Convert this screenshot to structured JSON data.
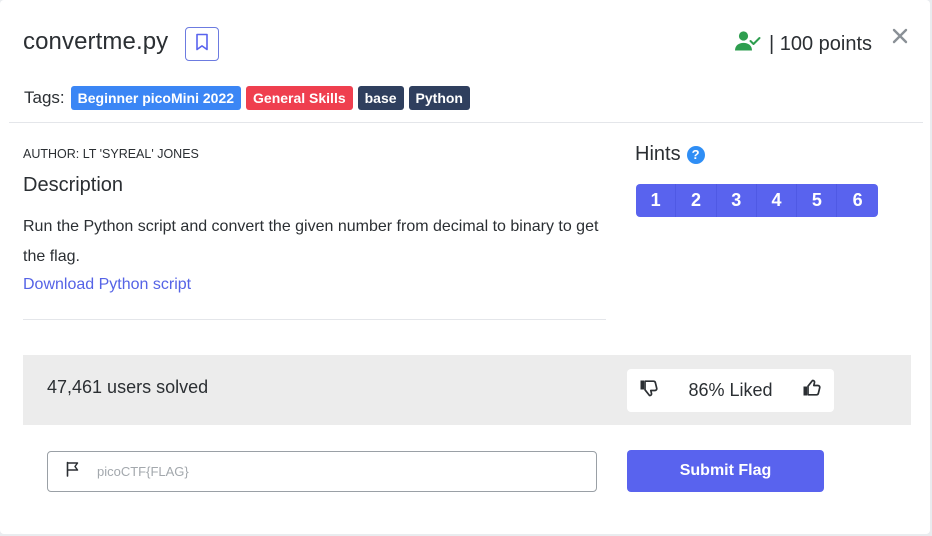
{
  "challenge": {
    "title": "convertme.py",
    "points_label": "| 100 points",
    "author": "AUTHOR: LT 'SYREAL' JONES",
    "description_heading": "Description",
    "description": "Run the Python script and convert the given number from decimal to binary to get the flag.",
    "download_link": "Download Python script"
  },
  "tags": {
    "label": "Tags:",
    "items": [
      {
        "label": "Beginner picoMini 2022",
        "color": "#3b86f5"
      },
      {
        "label": "General Skills",
        "color": "#ef3f4f"
      },
      {
        "label": "base",
        "color": "#2f3f5e"
      },
      {
        "label": "Python",
        "color": "#2f3f5e"
      }
    ]
  },
  "hints": {
    "title": "Hints",
    "help_glyph": "?",
    "buttons": [
      "1",
      "2",
      "3",
      "4",
      "5",
      "6"
    ]
  },
  "stats": {
    "solved": "47,461 users solved",
    "liked": "86% Liked"
  },
  "flag_form": {
    "placeholder": "picoCTF{FLAG}",
    "value": "",
    "submit_label": "Submit Flag"
  },
  "icons": {
    "bookmark": "bookmark-icon",
    "user_check": "user-check-icon",
    "close": "close-icon",
    "help": "help-circle-icon",
    "thumbs_down": "thumbs-down-icon",
    "thumbs_up": "thumbs-up-icon",
    "flag": "flag-icon"
  },
  "colors": {
    "accent": "#5963ee",
    "link": "#5563e6",
    "success": "#2e9e4f",
    "help": "#2f8ef5"
  }
}
